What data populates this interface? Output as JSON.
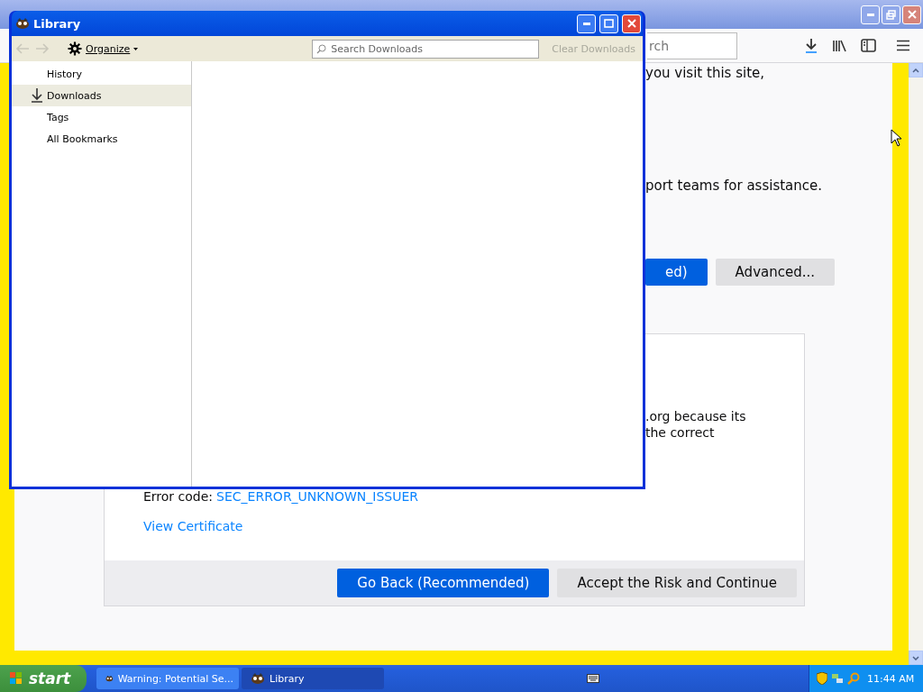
{
  "browser": {
    "search": {
      "placeholder": "rch"
    },
    "content": {
      "fragments": [
        "you visit this site,",
        "port teams for assistance."
      ],
      "buttons": [
        {
          "label": "ed)",
          "kind": "primary"
        },
        {
          "label": "Advanced...",
          "kind": "secondary"
        }
      ],
      "panel": {
        "lines": [
          ".org because its",
          "the correct"
        ],
        "error_label": "Error code:",
        "error_code": "SEC_ERROR_UNKNOWN_ISSUER",
        "link": "View Certificate",
        "buttons": [
          {
            "label": "Go Back (Recommended)",
            "kind": "primary"
          },
          {
            "label": "Accept the Risk and Continue",
            "kind": "secondary"
          }
        ]
      }
    }
  },
  "library": {
    "title": "Library",
    "organize": "Organize",
    "search": {
      "placeholder": "Search Downloads"
    },
    "clear": {
      "label": "Clear Downloads",
      "disabled": true
    },
    "sidebar": {
      "items": [
        {
          "label": "History",
          "selected": false
        },
        {
          "label": "Downloads",
          "selected": true
        },
        {
          "label": "Tags",
          "selected": false
        },
        {
          "label": "All Bookmarks",
          "selected": false
        }
      ]
    }
  },
  "taskbar": {
    "start": "start",
    "tasks": [
      {
        "label": "Warning: Potential Se...",
        "selected": false
      },
      {
        "label": "Library",
        "selected": true
      }
    ],
    "clock": "11:44 AM"
  }
}
